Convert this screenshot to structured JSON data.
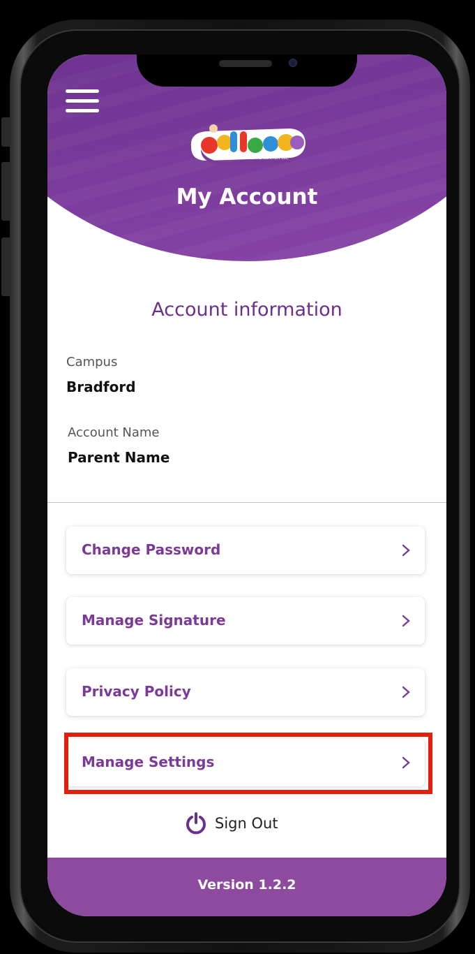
{
  "header": {
    "logo_text": "Lullaboo",
    "logo_subtext": "NURSERY & CHILDCARE CENTER INC",
    "title": "My Account"
  },
  "account": {
    "section_title": "Account information",
    "fields": [
      {
        "label": "Campus",
        "value": "Bradford"
      },
      {
        "label": "Account Name",
        "value": "Parent Name"
      }
    ]
  },
  "menu": {
    "items": [
      {
        "label": "Change Password"
      },
      {
        "label": "Manage Signature"
      },
      {
        "label": "Privacy Policy"
      },
      {
        "label": "Manage Settings"
      }
    ],
    "highlighted_item": "Manage Settings",
    "chevron_icon": "chevron-right-icon"
  },
  "sign_out": {
    "label": "Sign Out",
    "icon": "power-icon"
  },
  "footer": {
    "version": "Version 1.2.2"
  },
  "colors": {
    "brand_purple": "#6b2f8c",
    "footer_purple": "#8d4a9f",
    "highlight_red": "#e0200c"
  }
}
